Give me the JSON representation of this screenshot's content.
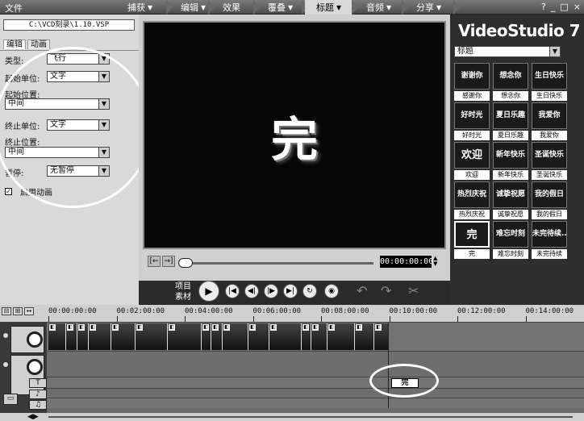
{
  "menu": {
    "file": "文件",
    "steps": [
      {
        "label": "捕获",
        "caret": "▼"
      },
      {
        "label": "编辑",
        "caret": "▼"
      },
      {
        "label": "效果",
        "caret": ""
      },
      {
        "label": "覆叠",
        "caret": "▼"
      },
      {
        "label": "标题",
        "caret": "▼"
      },
      {
        "label": "音频",
        "caret": "▼"
      },
      {
        "label": "分享",
        "caret": "▼"
      }
    ],
    "window_controls": [
      "?",
      "_",
      "□",
      "×"
    ]
  },
  "left_panel": {
    "file_path": "C:\\VCD刻录\\1.10.VSP",
    "tabs": [
      "编辑",
      "动画"
    ],
    "fields": [
      {
        "label": "类型:",
        "value": "飞行"
      },
      {
        "label": "起始单位:",
        "value": "文字"
      },
      {
        "label": "起始位置:",
        "value": "中间"
      },
      {
        "label": "终止单位:",
        "value": "文字"
      },
      {
        "label": "终止位置:",
        "value": "中间"
      },
      {
        "label": "暂停:",
        "value": "无暂停"
      }
    ],
    "checkbox_label": "启用动画",
    "checkbox_mark": "✓"
  },
  "preview": {
    "text": "完",
    "timecode": "00:00:00:00",
    "trim_in": "[←",
    "trim_out": "→]"
  },
  "library": {
    "brand": "VideoStudio 7",
    "category": "标题",
    "items": [
      {
        "thumb": "谢谢你",
        "caption": "感谢你"
      },
      {
        "thumb": "想念你",
        "caption": "想念你"
      },
      {
        "thumb": "生日快乐",
        "caption": "生日快乐"
      },
      {
        "thumb": "好时光",
        "caption": "好时光"
      },
      {
        "thumb": "夏日乐趣",
        "caption": "夏日乐趣"
      },
      {
        "thumb": "我爱你",
        "caption": "我爱你"
      },
      {
        "thumb": "欢迎",
        "caption": "欢迎"
      },
      {
        "thumb": "新年快乐",
        "caption": "新年快乐"
      },
      {
        "thumb": "圣诞快乐",
        "caption": "圣诞快乐"
      },
      {
        "thumb": "热烈庆祝",
        "caption": "热烈庆祝"
      },
      {
        "thumb": "诚挚祝愿",
        "caption": "诚挚祝愿"
      },
      {
        "thumb": "我的假日",
        "caption": "我的假日"
      },
      {
        "thumb": "完",
        "caption": "完"
      },
      {
        "thumb": "难忘时刻",
        "caption": "难忘时刻"
      },
      {
        "thumb": "未完待续...",
        "caption": "未完待续"
      }
    ],
    "selected_index": 12
  },
  "transport": {
    "project_label": "项目",
    "clip_label": "素材",
    "buttons": [
      "▶",
      "|◀",
      "◀|",
      "|▶",
      "▶|",
      "↻",
      "◉"
    ],
    "undo": "↶",
    "redo": "↷"
  },
  "timeline": {
    "zoom_controls": [
      "⊟",
      "⊞",
      "↔"
    ],
    "ticks": [
      "00:00:00:00",
      "00:02:00:00",
      "00:04:00:00",
      "00:06:00:00",
      "00:08:00:00",
      "00:10:00:00",
      "00:12:00:00",
      "00:14:00:00"
    ],
    "title_track_tag": "T",
    "voice_track_tag": "♪",
    "music_track_tag": "♫",
    "title_clip": "完",
    "nav": "◀▶",
    "folder": "▭"
  }
}
